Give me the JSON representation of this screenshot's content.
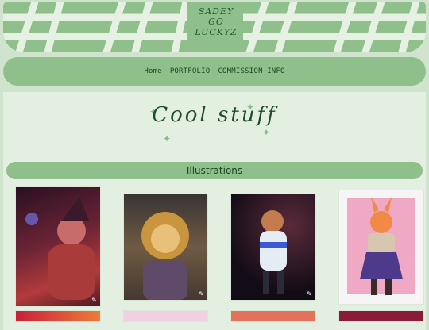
{
  "logo": {
    "line1": "SADEY",
    "line2": "GO",
    "line3": "LUCKYZ"
  },
  "nav": {
    "items": [
      {
        "label": "Home"
      },
      {
        "label": "PORTFOLIO"
      },
      {
        "label": "COMMISSION INFO"
      }
    ]
  },
  "page_title": "Cool stuff",
  "section": {
    "title": "Illustrations"
  },
  "gallery": [
    {
      "alt": "witch girl in red sweater",
      "colors": [
        "#3b1c2b",
        "#7a2f37",
        "#d1504a"
      ]
    },
    {
      "alt": "lion character in scarf",
      "colors": [
        "#2c2a28",
        "#6a4e3a",
        "#d8a24a"
      ]
    },
    {
      "alt": "character in winter coat on space background",
      "colors": [
        "#130d18",
        "#5a3a2c",
        "#e6ecf3"
      ]
    },
    {
      "alt": "fox girl in purple skirt",
      "colors": [
        "#f4c7d6",
        "#e26aa0",
        "#f0f0f0"
      ]
    }
  ],
  "colors": {
    "accent": "#8fc08b",
    "bg": "#cfe3cd",
    "text": "#1e4d2a"
  }
}
